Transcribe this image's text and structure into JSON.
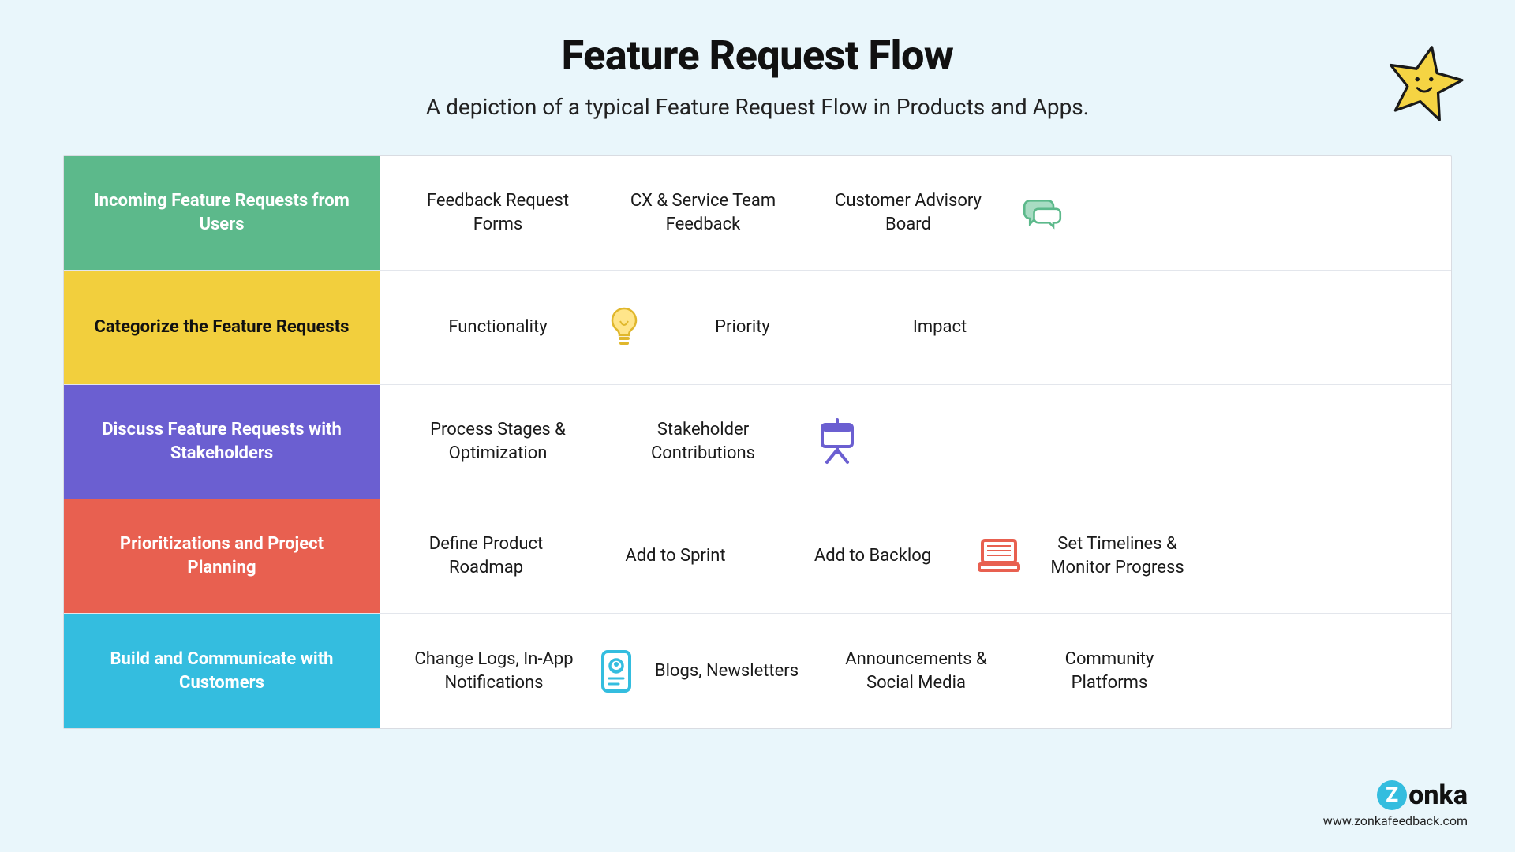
{
  "title": "Feature Request Flow",
  "subtitle": "A depiction of a typical Feature Request Flow in Products and Apps.",
  "rows": [
    {
      "label": "Incoming Feature Requests from Users",
      "items": [
        "Feedback Request Forms",
        "CX & Service Team Feedback",
        "Customer Advisory Board"
      ],
      "icon": "chat-icon"
    },
    {
      "label": "Categorize the Feature Requests",
      "items": [
        "Functionality",
        "Priority",
        "Impact"
      ],
      "icon": "lightbulb-icon"
    },
    {
      "label": "Discuss Feature Requests with Stakeholders",
      "items": [
        "Process Stages & Optimization",
        "Stakeholder Contributions"
      ],
      "icon": "easel-icon"
    },
    {
      "label": "Prioritizations and Project Planning",
      "items": [
        "Define Product Roadmap",
        "Add to Sprint",
        "Add to Backlog",
        "Set Timelines & Monitor Progress"
      ],
      "icon": "laptop-icon"
    },
    {
      "label": "Build and Communicate with Customers",
      "items": [
        "Change Logs, In-App Notifications",
        "Blogs, Newsletters",
        "Announcements & Social Media",
        "Community Platforms"
      ],
      "icon": "badge-icon"
    }
  ],
  "logo_text": "onka",
  "logo_letter": "Z",
  "footer_url": "www.zonkafeedback.com",
  "colors": {
    "green": "#5cb98b",
    "yellow": "#f2cf3d",
    "purple": "#6b5fd1",
    "red": "#e86050",
    "cyan": "#34bddf"
  }
}
